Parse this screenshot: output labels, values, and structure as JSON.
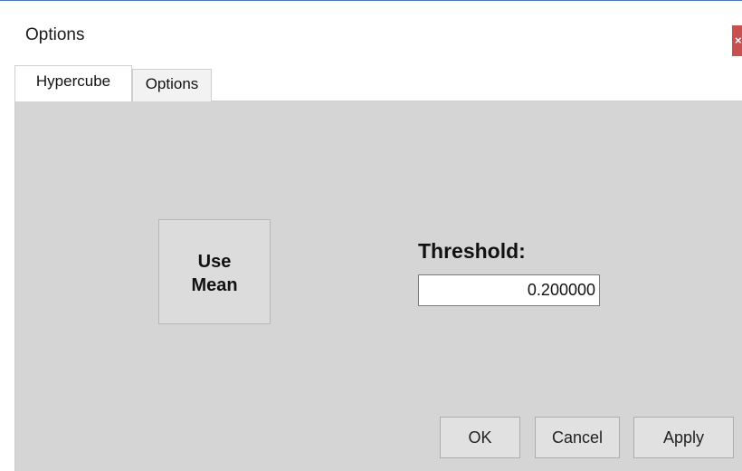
{
  "window": {
    "title": "Options",
    "close_glyph": "×"
  },
  "tabs": [
    {
      "label": "Hypercube",
      "active": true
    },
    {
      "label": "Options",
      "active": false
    }
  ],
  "hypercube_tab": {
    "use_mean_button": {
      "line1": "Use",
      "line2": "Mean"
    },
    "threshold": {
      "label": "Threshold:",
      "value": "0.200000"
    }
  },
  "footer": {
    "ok_label": "OK",
    "cancel_label": "Cancel",
    "apply_label": "Apply"
  },
  "colors": {
    "panel_bg": "#d5d5d5",
    "close_button": "#c75050",
    "title_top_border": "#4a78b8"
  }
}
